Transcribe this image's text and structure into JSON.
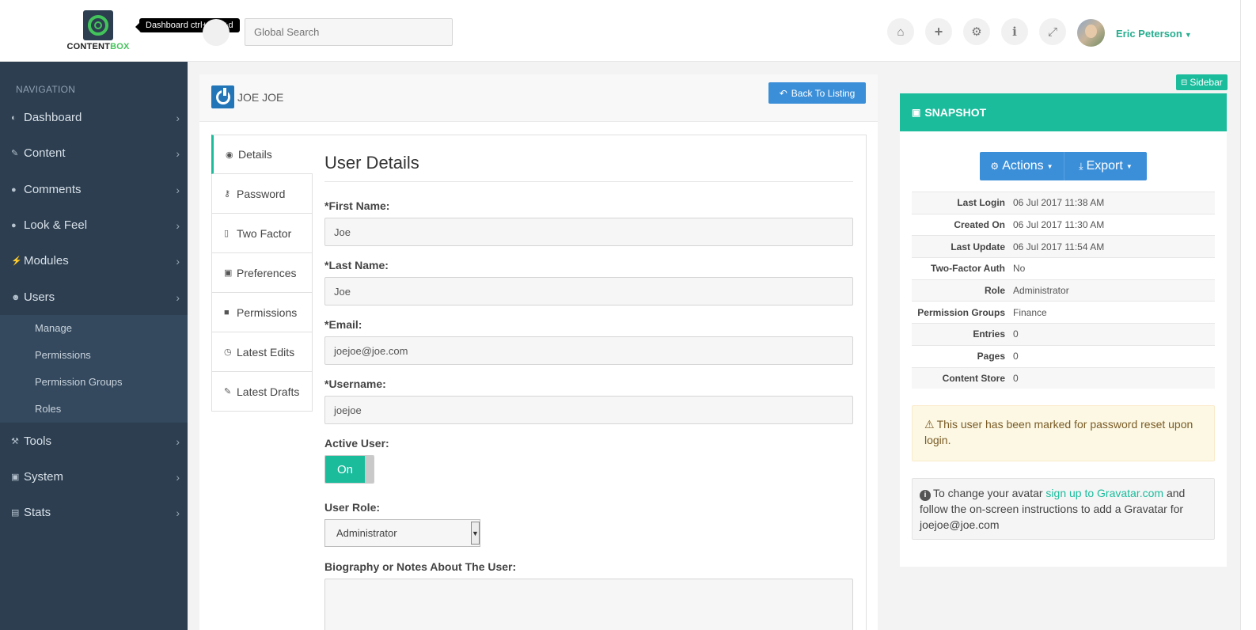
{
  "header": {
    "logo_text_a": "CONTENT",
    "logo_text_b": "BOX",
    "tooltip": "Dashboard ctrl+shift+d",
    "search_placeholder": "Global Search",
    "icons": [
      "home-icon",
      "plus-icon",
      "gear-icon",
      "info-icon",
      "expand-icon"
    ],
    "user_name": "Eric Peterson"
  },
  "sidebar": {
    "title": "NAVIGATION",
    "items": [
      {
        "label": "Dashboard",
        "icon": "dashboard-icon"
      },
      {
        "label": "Content",
        "icon": "pencil-icon"
      },
      {
        "label": "Comments",
        "icon": "comment-icon"
      },
      {
        "label": "Look & Feel",
        "icon": "tint-icon"
      },
      {
        "label": "Modules",
        "icon": "bolt-icon"
      },
      {
        "label": "Users",
        "icon": "user-icon"
      },
      {
        "label": "Tools",
        "icon": "wrench-icon"
      },
      {
        "label": "System",
        "icon": "briefcase-icon"
      },
      {
        "label": "Stats",
        "icon": "bar-chart-icon"
      }
    ],
    "sub_items": [
      "Manage",
      "Permissions",
      "Permission Groups",
      "Roles"
    ]
  },
  "main": {
    "title": "JOE JOE",
    "back_label": "Back To Listing",
    "tabs": [
      "Details",
      "Password",
      "Two Factor",
      "Preferences",
      "Permissions",
      "Latest Edits",
      "Latest Drafts"
    ],
    "section_title": "User Details",
    "fields": {
      "first_name_label": "*First Name:",
      "first_name_value": "Joe",
      "last_name_label": "*Last Name:",
      "last_name_value": "Joe",
      "email_label": "*Email:",
      "email_value": "joejoe@joe.com",
      "username_label": "*Username:",
      "username_value": "joejoe",
      "active_label": "Active User:",
      "active_value": "On",
      "role_label": "User Role:",
      "role_value": "Administrator",
      "bio_label": "Biography or Notes About The User:"
    }
  },
  "snapshot": {
    "sidebar_toggle": "Sidebar",
    "title": "SNAPSHOT",
    "actions_label": "Actions",
    "export_label": "Export",
    "rows": [
      {
        "k": "Last Login",
        "v": "06 Jul 2017 11:38 AM"
      },
      {
        "k": "Created On",
        "v": "06 Jul 2017 11:30 AM"
      },
      {
        "k": "Last Update",
        "v": "06 Jul 2017 11:54 AM"
      },
      {
        "k": "Two-Factor Auth",
        "v": "No"
      },
      {
        "k": "Role",
        "v": "Administrator"
      },
      {
        "k": "Permission Groups",
        "v": "Finance"
      },
      {
        "k": "Entries",
        "v": "0"
      },
      {
        "k": "Pages",
        "v": "0"
      },
      {
        "k": "Content Store",
        "v": "0"
      }
    ],
    "warning": "This user has been marked for password reset upon login.",
    "info_prefix": "To change your avatar ",
    "info_link": "sign up to Gravatar.com",
    "info_suffix": " and follow the on-screen instructions to add a Gravatar for joejoe@joe.com"
  }
}
